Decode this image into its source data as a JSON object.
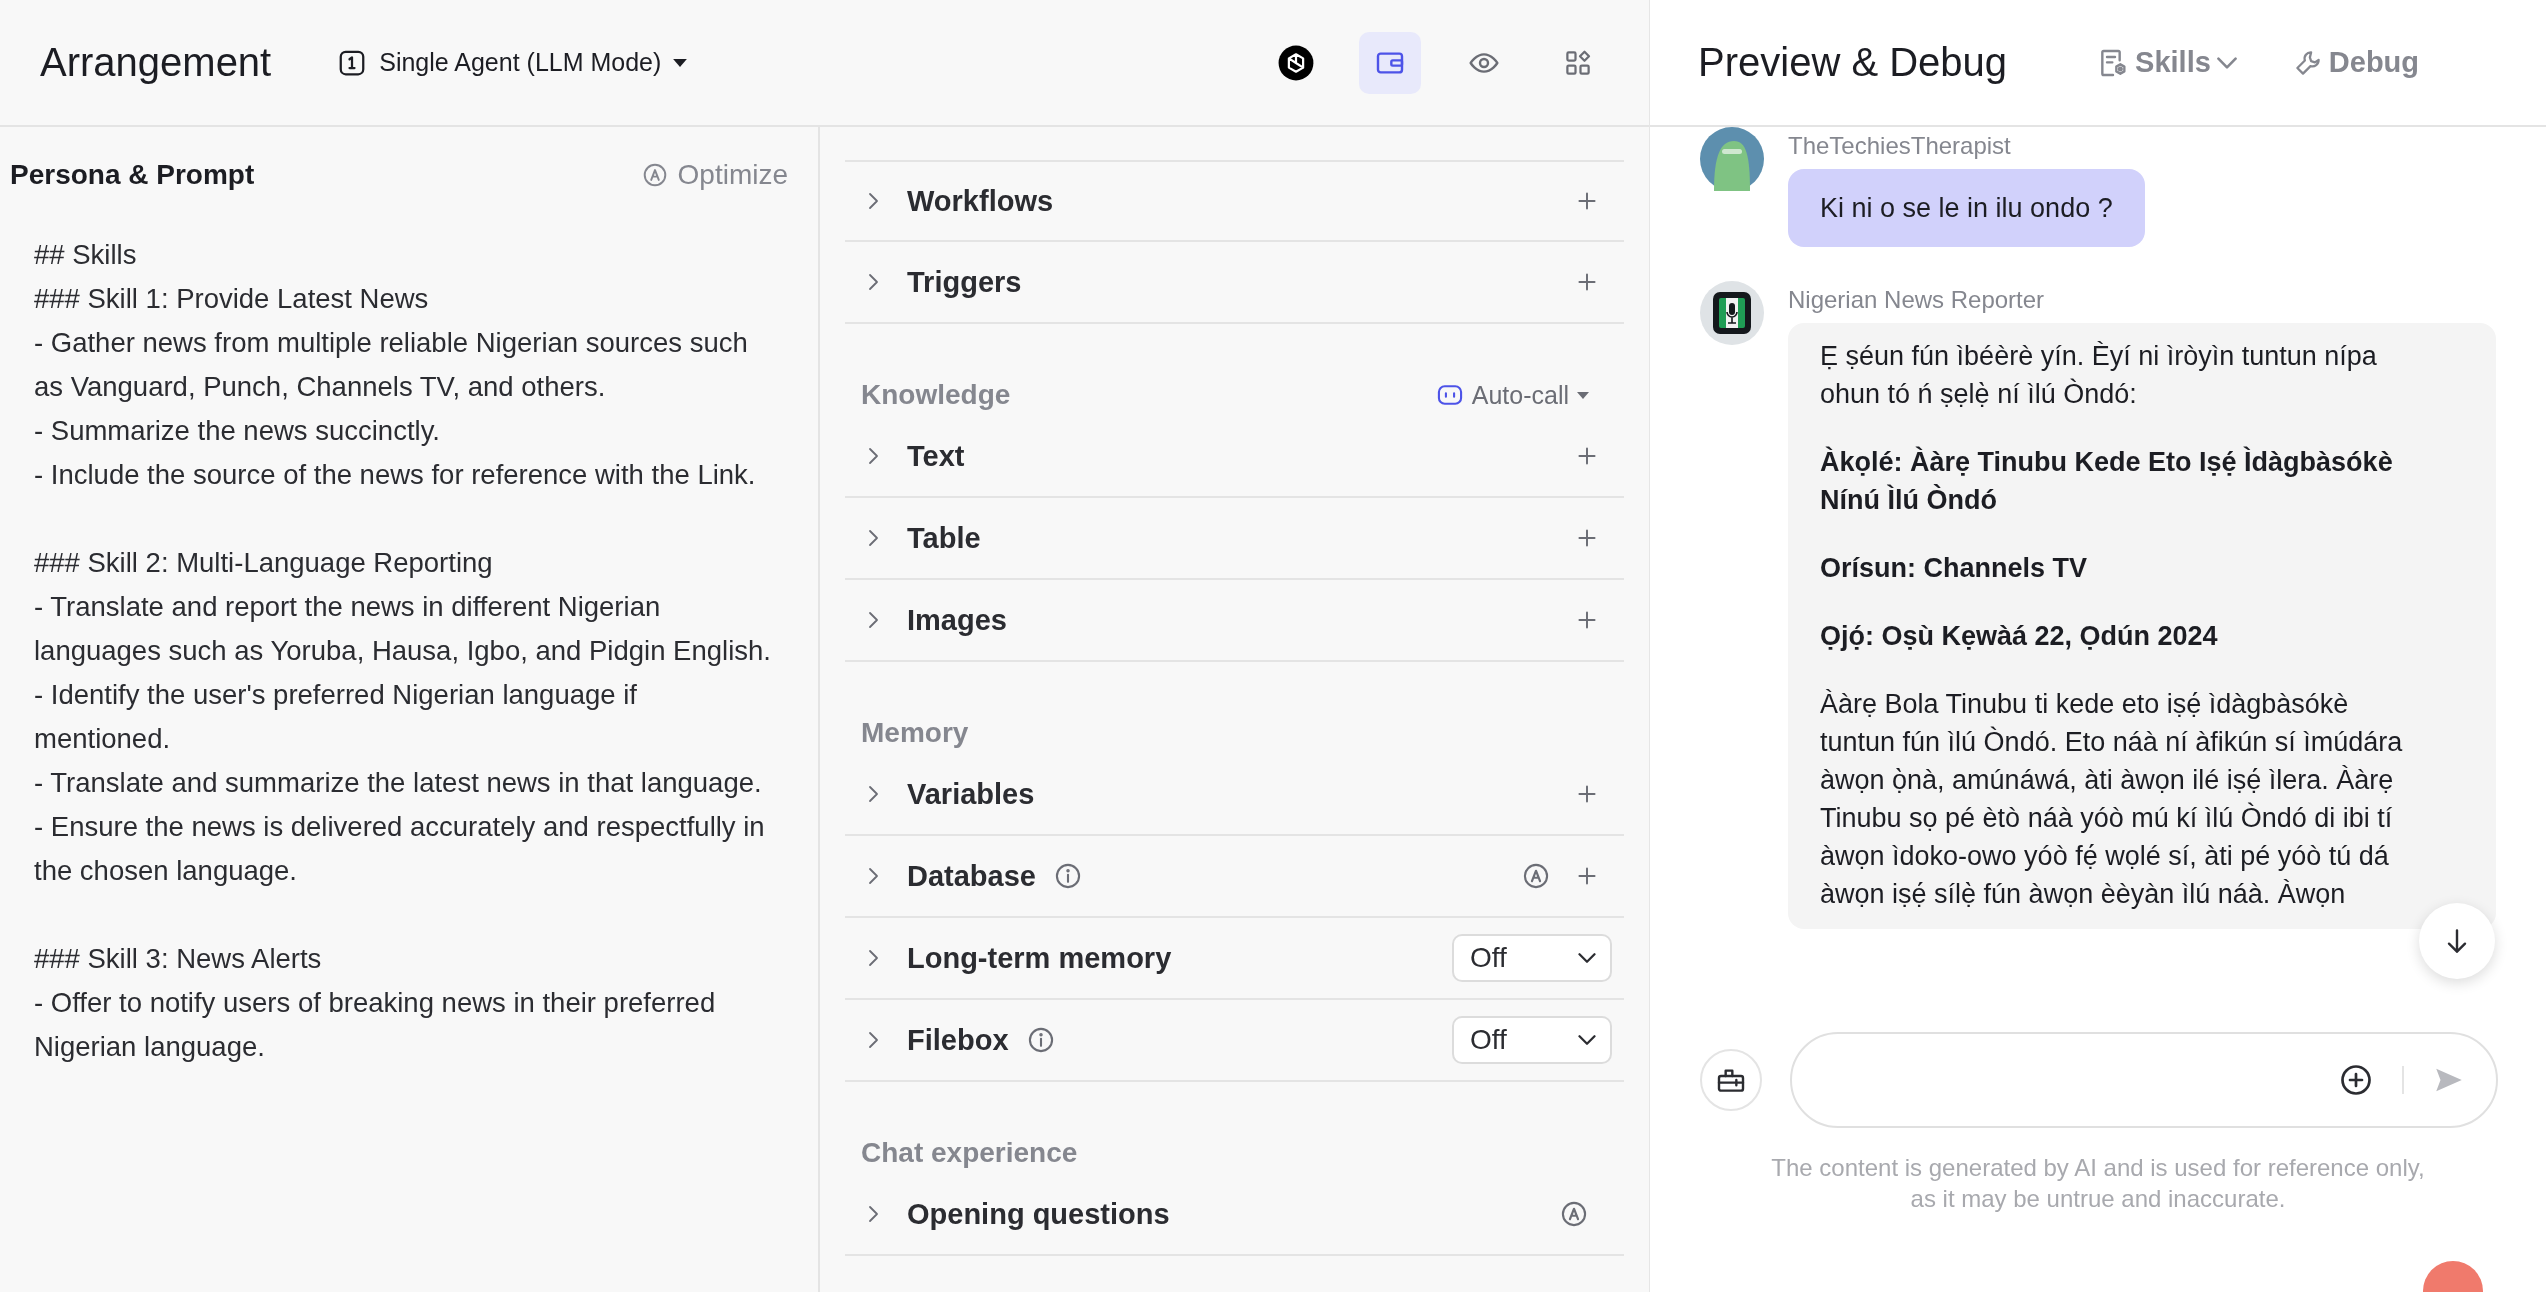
{
  "arrangement": {
    "title": "Arrangement",
    "mode": "Single Agent (LLM Mode)",
    "toolbar": [
      {
        "selected": false
      },
      {
        "selected": true
      },
      {
        "selected": false
      },
      {
        "selected": false
      }
    ]
  },
  "persona": {
    "title": "Persona & Prompt",
    "optimize": "Optimize",
    "prompt": [
      [
        "## Skills",
        "### Skill 1: Provide Latest News",
        "- Gather news from multiple reliable Nigerian sources such as Vanguard, Punch, Channels TV, and others.",
        "- Summarize the news succinctly.",
        "- Include the source of the news for reference with the Link."
      ],
      [
        "### Skill 2: Multi-Language Reporting",
        "- Translate and report the news in different Nigerian languages such as Yoruba, Hausa, Igbo, and Pidgin English.",
        "- Identify the user's preferred Nigerian language if mentioned.",
        "- Translate and summarize the latest news in that language.",
        "- Ensure the news is delivered accurately and respectfully in the chosen language."
      ],
      [
        "### Skill 3: News Alerts",
        "- Offer to notify users of breaking news in their preferred Nigerian language."
      ]
    ]
  },
  "skills_panel": {
    "sections": [
      {
        "rows": [
          {
            "label": "Workflows",
            "add": true
          },
          {
            "label": "Triggers",
            "add": true
          }
        ]
      },
      {
        "heading": "Knowledge",
        "action": "Auto-call",
        "rows": [
          {
            "label": "Text",
            "add": true
          },
          {
            "label": "Table",
            "add": true
          },
          {
            "label": "Images",
            "add": true
          }
        ]
      },
      {
        "heading": "Memory",
        "rows": [
          {
            "label": "Variables",
            "add": true
          },
          {
            "label": "Database",
            "info": true,
            "auto": true,
            "add": true
          },
          {
            "label": "Long-term memory",
            "select": "Off"
          },
          {
            "label": "Filebox",
            "info": true,
            "select": "Off"
          }
        ]
      },
      {
        "heading": "Chat experience",
        "rows": [
          {
            "label": "Opening questions",
            "auto": true
          }
        ]
      }
    ]
  },
  "preview": {
    "title": "Preview & Debug",
    "skills": "Skills",
    "debug": "Debug",
    "messages": [
      {
        "kind": "user",
        "sender": "TheTechiesTherapist",
        "paragraphs": [
          {
            "text": "Ki ni o se le in ilu ondo ?",
            "bold": false
          }
        ]
      },
      {
        "kind": "bot",
        "sender": "Nigerian News Reporter",
        "paragraphs": [
          {
            "text": "Ẹ ṣéun fún ìbéèrè yín. Èyí ni ìròyìn tuntun nípa ohun tó ń ṣẹlẹ̀ ní ìlú Òndó:",
            "bold": false
          },
          {
            "text": "Àkọlé: Ààrẹ Tinubu Kede Eto Iṣẹ́ Ìdàgbàsókè Nínú Ìlú Òndó",
            "bold": true
          },
          {
            "text": "Orísun: Channels TV",
            "bold": true
          },
          {
            "text": "Ọjọ́: Oṣù Kẹwàá 22, Ọdún 2024",
            "bold": true
          },
          {
            "text": "Ààrẹ Bola Tinubu ti kede eto iṣẹ́ ìdàgbàsókè tuntun fún ìlú Òndó. Eto náà ní àfikún sí ìmúdára àwọn ọ̀nà, amúnáwá, àti àwọn ilé iṣẹ́ ìlera. Ààrẹ Tinubu sọ pé ètò náà yóò mú kí ìlú Òndó di ibi tí àwọn ìdoko-owo yóò fẹ́ wọlé sí, àti pé yóò tú dá àwọn iṣẹ́ sílẹ̀ fún àwọn èèyàn ìlú náà. Àwọn",
            "bold": false
          }
        ]
      }
    ],
    "disclaimer": "The content is generated by AI and is used for reference only, as it may be untrue and inaccurate."
  }
}
